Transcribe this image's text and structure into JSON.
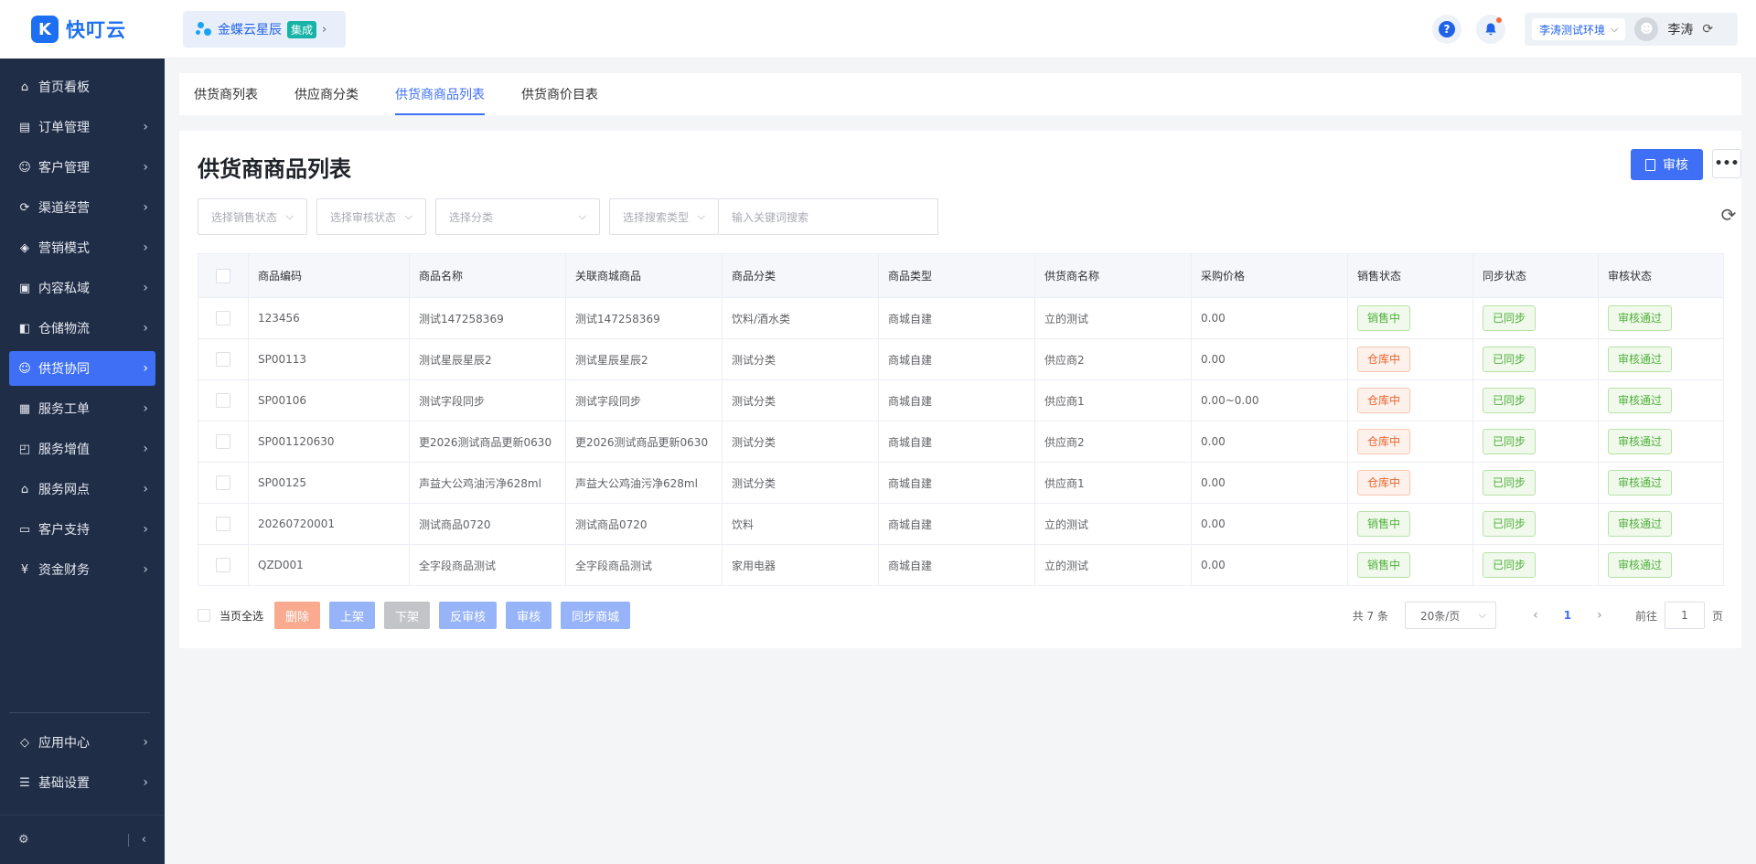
{
  "app": {
    "logo_mark": "K",
    "logo_text": "快叮云"
  },
  "header": {
    "org_name": "金蝶云星辰",
    "org_badge": "集成",
    "env_label": "李涛测试环境",
    "user_name": "李涛"
  },
  "sidebar": {
    "items": [
      {
        "label": "首页看板",
        "icon": "home-icon",
        "glyph": "⌂",
        "chevron": false,
        "active": false
      },
      {
        "label": "订单管理",
        "icon": "clipboard-icon",
        "glyph": "▤",
        "chevron": true,
        "active": false
      },
      {
        "label": "客户管理",
        "icon": "user-icon",
        "glyph": "☺",
        "chevron": true,
        "active": false
      },
      {
        "label": "渠道经营",
        "icon": "cycle-icon",
        "glyph": "⟳",
        "chevron": true,
        "active": false
      },
      {
        "label": "营销模式",
        "icon": "tag-icon",
        "glyph": "◈",
        "chevron": true,
        "active": false
      },
      {
        "label": "内容私域",
        "icon": "image-icon",
        "glyph": "▣",
        "chevron": true,
        "active": false
      },
      {
        "label": "仓储物流",
        "icon": "box-icon",
        "glyph": "◧",
        "chevron": true,
        "active": false
      },
      {
        "label": "供货协同",
        "icon": "supplier-icon",
        "glyph": "☺",
        "chevron": true,
        "active": true
      },
      {
        "label": "服务工单",
        "icon": "ticket-icon",
        "glyph": "▦",
        "chevron": true,
        "active": false
      },
      {
        "label": "服务增值",
        "icon": "bag-icon",
        "glyph": "◰",
        "chevron": true,
        "active": false
      },
      {
        "label": "服务网点",
        "icon": "store-icon",
        "glyph": "⌂",
        "chevron": true,
        "active": false
      },
      {
        "label": "客户支持",
        "icon": "support-icon",
        "glyph": "▭",
        "chevron": true,
        "active": false
      },
      {
        "label": "资金财务",
        "icon": "yen-icon",
        "glyph": "¥",
        "chevron": true,
        "active": false
      }
    ],
    "bottom_items": [
      {
        "label": "应用中心",
        "icon": "cube-icon",
        "glyph": "◇"
      },
      {
        "label": "基础设置",
        "icon": "sliders-icon",
        "glyph": "☰"
      }
    ]
  },
  "tabs": [
    {
      "label": "供货商列表",
      "active": false
    },
    {
      "label": "供应商分类",
      "active": false
    },
    {
      "label": "供货商商品列表",
      "active": true
    },
    {
      "label": "供货商价目表",
      "active": false
    }
  ],
  "page": {
    "title": "供货商商品列表",
    "audit_button": "审核",
    "more_button": "•••"
  },
  "filters": {
    "sales_status": "选择销售状态",
    "audit_status": "选择审核状态",
    "category": "选择分类",
    "search_type": "选择搜索类型",
    "keyword_placeholder": "输入关键词搜索"
  },
  "table": {
    "columns": [
      "商品编码",
      "商品名称",
      "关联商城商品",
      "商品分类",
      "商品类型",
      "供货商名称",
      "采购价格",
      "销售状态",
      "同步状态",
      "审核状态"
    ],
    "rows": [
      {
        "code": "123456",
        "name": "测试147258369",
        "linked": "测试147258369",
        "category": "饮料/酒水类",
        "type": "商城自建",
        "supplier": "立的测试",
        "price": "0.00",
        "sales": "销售中",
        "sales_color": "green",
        "sync": "已同步",
        "audit": "审核通过"
      },
      {
        "code": "SP00113",
        "name": "测试星辰星辰2",
        "linked": "测试星辰星辰2",
        "category": "测试分类",
        "type": "商城自建",
        "supplier": "供应商2",
        "price": "0.00",
        "sales": "仓库中",
        "sales_color": "red",
        "sync": "已同步",
        "audit": "审核通过"
      },
      {
        "code": "SP00106",
        "name": "测试字段同步",
        "linked": "测试字段同步",
        "category": "测试分类",
        "type": "商城自建",
        "supplier": "供应商1",
        "price": "0.00~0.00",
        "sales": "仓库中",
        "sales_color": "red",
        "sync": "已同步",
        "audit": "审核通过"
      },
      {
        "code": "SP001120630",
        "name": "更2026测试商品更新0630",
        "linked": "更2026测试商品更新0630",
        "category": "测试分类",
        "type": "商城自建",
        "supplier": "供应商2",
        "price": "0.00",
        "sales": "仓库中",
        "sales_color": "red",
        "sync": "已同步",
        "audit": "审核通过"
      },
      {
        "code": "SP00125",
        "name": "声益大公鸡油污净628ml",
        "linked": "声益大公鸡油污净628ml",
        "category": "测试分类",
        "type": "商城自建",
        "supplier": "供应商1",
        "price": "0.00",
        "sales": "仓库中",
        "sales_color": "red",
        "sync": "已同步",
        "audit": "审核通过"
      },
      {
        "code": "20260720001",
        "name": "测试商品0720",
        "linked": "测试商品0720",
        "category": "饮料",
        "type": "商城自建",
        "supplier": "立的测试",
        "price": "0.00",
        "sales": "销售中",
        "sales_color": "green",
        "sync": "已同步",
        "audit": "审核通过"
      },
      {
        "code": "QZD001",
        "name": "全字段商品测试",
        "linked": "全字段商品测试",
        "category": "家用电器",
        "type": "商城自建",
        "supplier": "立的测试",
        "price": "0.00",
        "sales": "销售中",
        "sales_color": "green",
        "sync": "已同步",
        "audit": "审核通过"
      }
    ]
  },
  "bulk": {
    "select_all": "当页全选",
    "buttons": [
      {
        "label": "删除",
        "style": "red",
        "name": "delete-button"
      },
      {
        "label": "上架",
        "style": "blue",
        "name": "list-on-shelf-button"
      },
      {
        "label": "下架",
        "style": "gray",
        "name": "remove-from-shelf-button"
      },
      {
        "label": "反审核",
        "style": "blue",
        "name": "unaudit-button"
      },
      {
        "label": "审核",
        "style": "blue",
        "name": "bulk-audit-button"
      },
      {
        "label": "同步商城",
        "style": "blue",
        "name": "sync-mall-button"
      }
    ]
  },
  "pagination": {
    "total": "共 7 条",
    "page_size": "20条/页",
    "current_page": "1",
    "goto_label": "前往",
    "goto_value": "1",
    "goto_suffix": "页"
  },
  "colors": {
    "primary": "#3e6ff5",
    "sidebar_bg": "#1f2d47",
    "success": "#4eb03b",
    "warning": "#e5662e"
  }
}
